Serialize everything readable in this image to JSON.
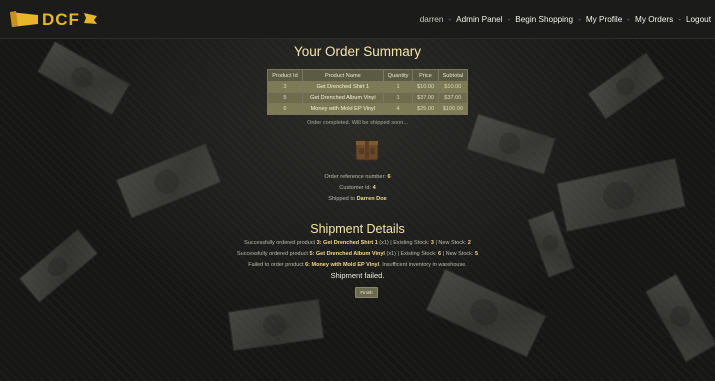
{
  "nav": {
    "user": "darren",
    "links": [
      "Admin Panel",
      "Begin Shopping",
      "My Profile",
      "My Orders",
      "Logout"
    ],
    "logo_text": "DCF"
  },
  "summary": {
    "title": "Your Order Summary",
    "columns": [
      "Product Id",
      "Product Name",
      "Quantity",
      "Price",
      "Subtotal"
    ],
    "rows": [
      [
        "3",
        "Get Drenched Shirt 1",
        "1",
        "$10.00",
        "$10.00"
      ],
      [
        "5",
        "Get Drenched Album Vinyl",
        "1",
        "$37.00",
        "$37.00"
      ],
      [
        "6",
        "Money with Mold EP Vinyl",
        "4",
        "$25.00",
        "$100.00"
      ]
    ],
    "completed_text": "Order completed. Will be shipped soon..."
  },
  "order_info": {
    "reference_label": "Order reference number:",
    "reference_value": "6",
    "customer_label": "Customer id:",
    "customer_value": "4",
    "shipped_label": "Shipped to",
    "shipped_value": "Darren Doe"
  },
  "shipment": {
    "title": "Shipment Details",
    "line1": {
      "a": "Successfully ordered product",
      "id": "3:",
      "name": "Get Drenched Shirt 1",
      "b": "(x1) | Existing Stock:",
      "stock": "3",
      "c": "| New Stock:",
      "new": "2"
    },
    "line2": {
      "a": "Successfully ordered product",
      "id": "5:",
      "name": "Get Drenched Album Vinyl",
      "b": "(x1) | Existing Stock:",
      "stock": "6",
      "c": "| New Stock:",
      "new": "5"
    },
    "line3": {
      "a": "Failed to order product",
      "id": "6:",
      "name": "Money with Mold EP Vinyl",
      "b": ". Insufficent inventory in warehouse."
    },
    "status": "Shipment failed.",
    "finish_label": "Finish"
  },
  "colors": {
    "accent": "#f5d98a",
    "title": "#f5e6a8",
    "table_header": "#5b5a44",
    "table_row": "#7d7b55",
    "nav_bg": "#1b1b1a"
  }
}
